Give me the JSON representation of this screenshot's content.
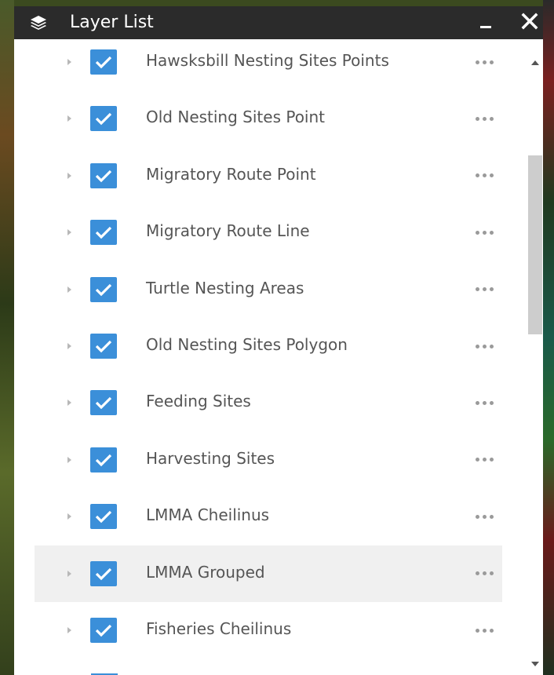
{
  "window": {
    "title": "Layer List",
    "title_icon": "layers-icon",
    "minimize_icon": "minimize-icon",
    "close_icon": "close-icon"
  },
  "colors": {
    "titlebar_bg": "#2b2b2b",
    "checkbox_blue": "#3b8fd9",
    "label_text": "#555555",
    "row_highlight": "#f0f0f0"
  },
  "layers": [
    {
      "label": "Hawsksbill Nesting Sites Points",
      "checked": true
    },
    {
      "label": "Old Nesting Sites Point",
      "checked": true
    },
    {
      "label": "Migratory Route Point",
      "checked": true
    },
    {
      "label": "Migratory Route Line",
      "checked": true
    },
    {
      "label": "Turtle Nesting Areas",
      "checked": true
    },
    {
      "label": "Old Nesting Sites Polygon",
      "checked": true
    },
    {
      "label": "Feeding Sites",
      "checked": true
    },
    {
      "label": "Harvesting Sites",
      "checked": true
    },
    {
      "label": "LMMA Cheilinus",
      "checked": true
    },
    {
      "label": "LMMA Grouped",
      "checked": true,
      "hovered": true
    },
    {
      "label": "Fisheries Cheilinus",
      "checked": true
    }
  ],
  "row_icons": {
    "expand": "triangle-right-icon",
    "checkbox": "checkmark-icon",
    "more": "more-options-icon"
  }
}
